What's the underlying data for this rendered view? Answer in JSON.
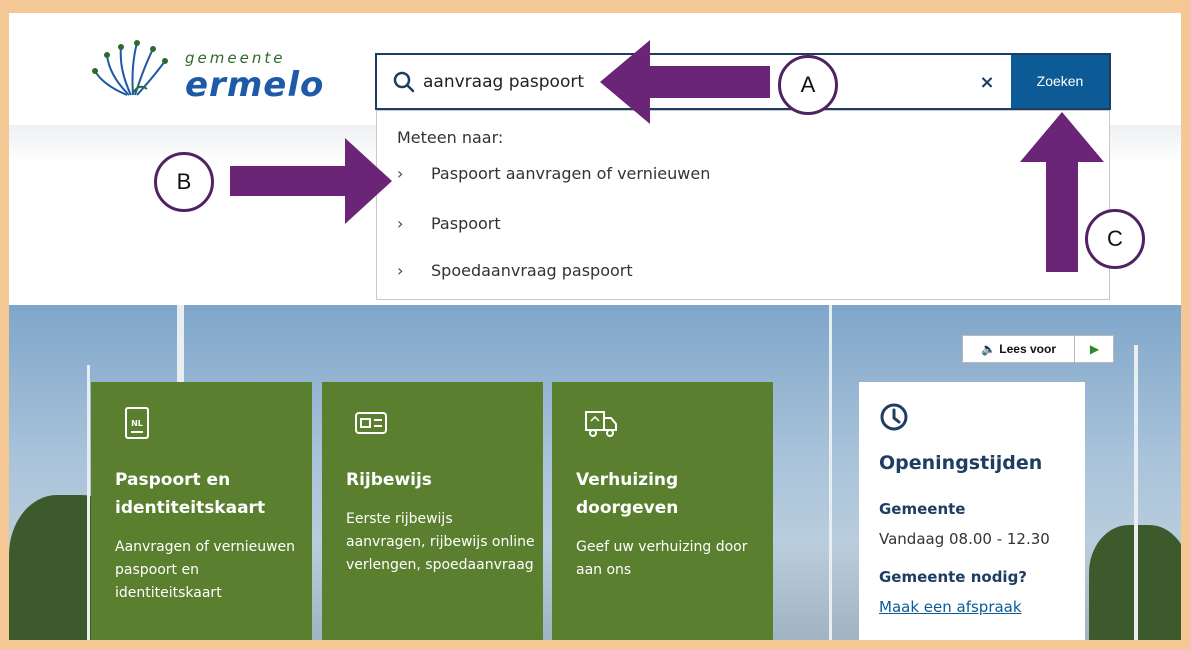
{
  "logo": {
    "line1": "gemeente",
    "line2": "ermelo"
  },
  "search": {
    "value": "aanvraag paspoort",
    "clear_label": "×",
    "button_label": "Zoeken"
  },
  "dropdown": {
    "heading": "Meteen naar:",
    "items": [
      {
        "label": "Paspoort aanvragen of vernieuwen"
      },
      {
        "label": "Paspoort"
      },
      {
        "label": "Spoedaanvraag paspoort"
      }
    ]
  },
  "read_aloud": {
    "label": "Lees voor",
    "play_icon": "play-icon",
    "speaker_icon": "speaker-icon"
  },
  "tiles": [
    {
      "title": "Paspoort en identiteitskaart",
      "text": "Aanvragen of vernieuwen paspoort en identiteitskaart",
      "icon": "passport-icon",
      "icon_text": "NL"
    },
    {
      "title": "Rijbewijs",
      "text": "Eerste rijbewijs aanvragen, rijbewijs online verlengen, spoedaanvraag",
      "icon": "id-card-icon"
    },
    {
      "title": "Verhuizing doorgeven",
      "text": "Geef uw verhuizing door aan ons",
      "icon": "moving-truck-icon"
    }
  ],
  "hours": {
    "title": "Openingstijden",
    "section1": "Gemeente",
    "today": "Vandaag 08.00 - 12.30",
    "section2": "Gemeente nodig?",
    "link": "Maak een afspraak"
  },
  "annotations": {
    "a": "A",
    "b": "B",
    "c": "C",
    "arrow_color": "#6a2576"
  },
  "colors": {
    "tile_green": "#5a7f2e",
    "search_button": "#0c5b96",
    "frame_border": "#f4c894",
    "navy": "#1d3d63"
  }
}
